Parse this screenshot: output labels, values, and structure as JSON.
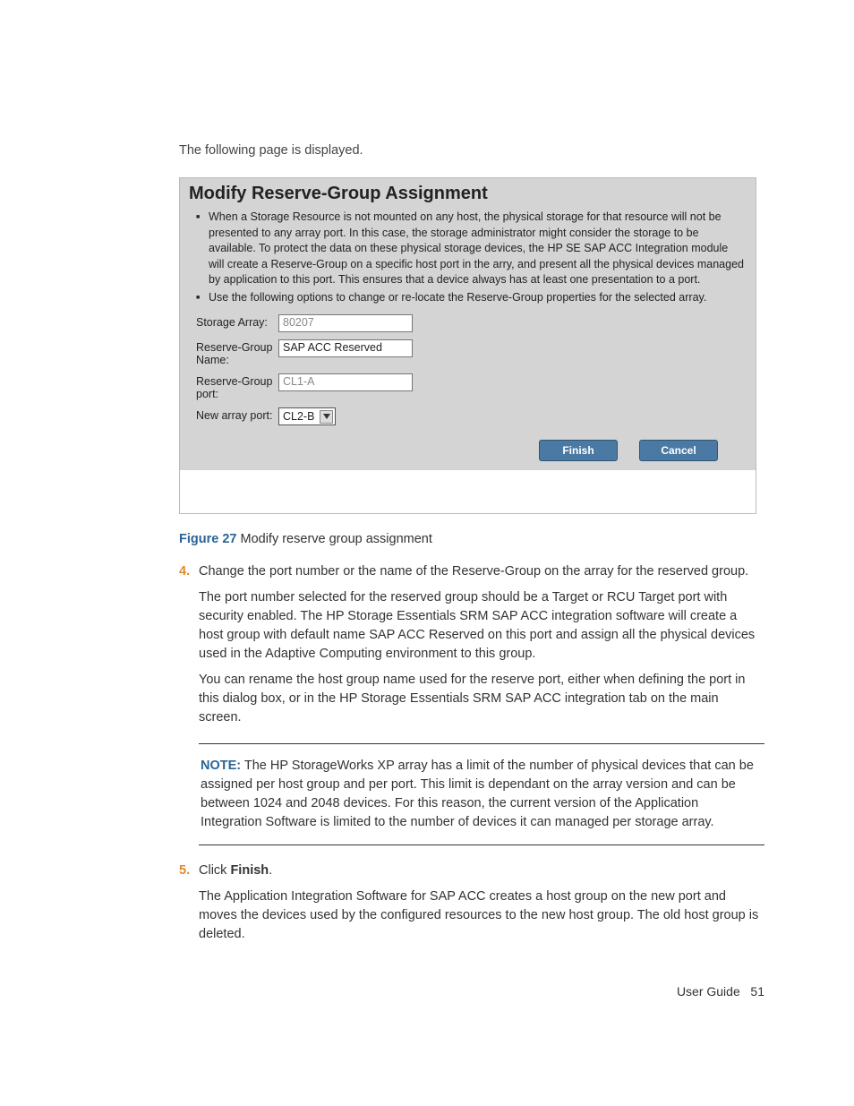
{
  "intro": "The following page is displayed.",
  "panel": {
    "title": "Modify Reserve-Group Assignment",
    "bullets": [
      "When a Storage Resource is not mounted on any host, the physical storage for that resource will not be presented to any array port. In this case, the storage administrator might consider the storage to be available. To protect the data on these physical storage devices, the HP SE SAP ACC Integration module will create a Reserve-Group on a specific host port in the arry, and present all the physical devices managed by application to this port. This ensures that a device always has at least one presentation to a port.",
      "Use the following options to change or re-locate the Reserve-Group properties for the selected array."
    ],
    "form": {
      "storage_array_label": "Storage Array:",
      "storage_array_value": "80207",
      "group_name_label": "Reserve-Group Name:",
      "group_name_value": "SAP ACC Reserved",
      "group_port_label": "Reserve-Group port:",
      "group_port_value": "CL1-A",
      "new_port_label": "New array port:",
      "new_port_value": "CL2-B"
    },
    "buttons": {
      "finish": "Finish",
      "cancel": "Cancel"
    }
  },
  "figure": {
    "label": "Figure 27",
    "caption": " Modify reserve group assignment"
  },
  "steps": {
    "s4": {
      "num": "4.",
      "lead": "Change the port number or the name of the Reserve-Group on the array for the reserved group.",
      "p1": "The port number selected for the reserved group should be a Target or RCU Target port with security enabled. The HP Storage Essentials SRM SAP ACC integration software will create a host group with default name SAP ACC Reserved on this port and assign all the physical devices used in the Adaptive Computing environment to this group.",
      "p2": "You can rename the host group name used for the reserve port, either when defining the port in this dialog box, or in the HP Storage Essentials SRM SAP ACC integration tab on the main screen."
    },
    "s5": {
      "num": "5.",
      "lead_prefix": "Click ",
      "lead_bold": "Finish",
      "lead_suffix": ".",
      "p1": "The Application Integration Software for SAP ACC creates a host group on the new port and moves the devices used by the configured resources to the new host group. The old host group is deleted."
    }
  },
  "note": {
    "label": "NOTE:",
    "text": "   The HP StorageWorks XP array has a limit of the number of physical devices that can be assigned per host group and per port. This limit is dependant on the array version and can be between 1024 and 2048 devices. For this reason, the current version of the Application Integration Software is limited to the number of devices it can managed per storage array."
  },
  "footer": {
    "label": "User Guide",
    "page": "51"
  }
}
